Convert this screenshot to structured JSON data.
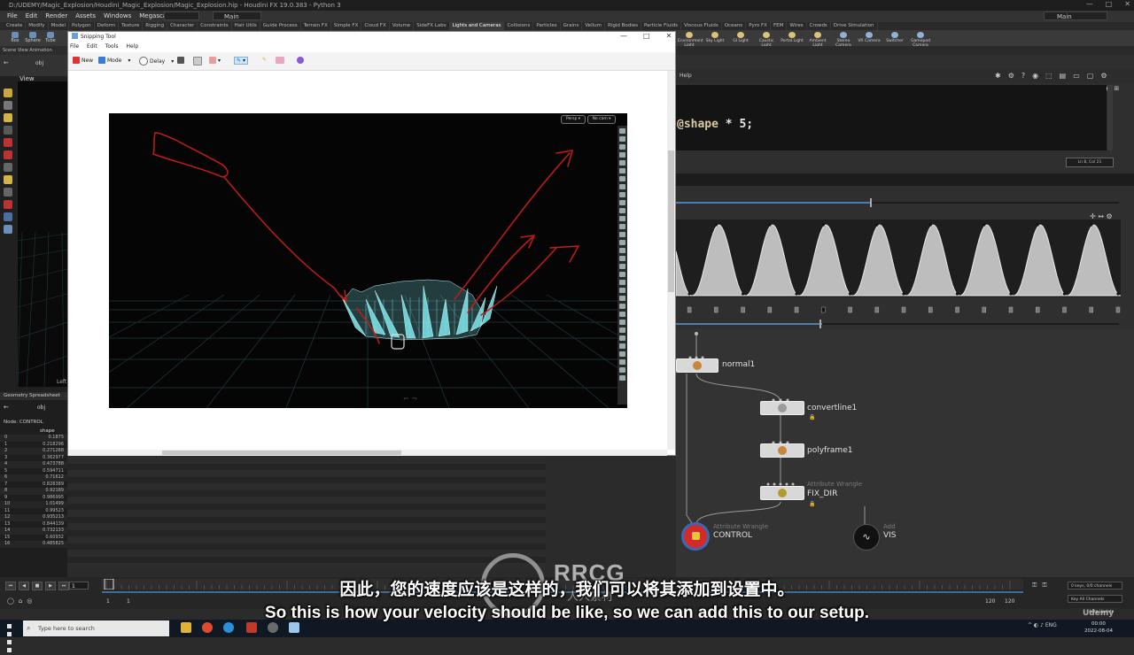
{
  "window": {
    "title": "D:/UDEMY/Magic_Explosion/Houdini_Magic_Explosion/Magic_Explosion.hip - Houdini FX 19.0.383 - Python 3",
    "controls": [
      "—",
      "□",
      "✕"
    ]
  },
  "menubar": [
    "File",
    "Edit",
    "Render",
    "Assets",
    "Windows",
    "Megascans",
    "Help"
  ],
  "build_selector": "Main",
  "desktop_selector": "Main",
  "shelf_tabs": [
    "Create",
    "Modify",
    "Model",
    "Polygon",
    "Deform",
    "Texture",
    "Rigging",
    "Character",
    "Constraints",
    "Hair Utils",
    "Guide Process",
    "Terrain FX",
    "Simple FX",
    "Cloud FX",
    "Volume",
    "SideFX Labs",
    "Lights and Cameras",
    "Collisions",
    "Particles",
    "Grains",
    "Vellum",
    "Rigid Bodies",
    "Particle Fluids",
    "Viscous Fluids",
    "Oceans",
    "Pyro FX",
    "FEM",
    "Wires",
    "Crowds",
    "Drive Simulation"
  ],
  "shelf_tools_left": [
    "Box",
    "Sphere",
    "Tube"
  ],
  "shelf_lights": [
    "Environment Light",
    "Sky Light",
    "GI Light",
    "Caustic Light",
    "Portal Light",
    "Ambient Light",
    "Stereo Camera",
    "VR Camera",
    "Switcher",
    "Gamepad Camera"
  ],
  "left_pane": {
    "tabs": "Scene View   Animation",
    "path": "obj",
    "view_label": "View",
    "axis_label": "Left"
  },
  "spreadsheet": {
    "tab": "Geometry Spreadsheet",
    "path": "obj",
    "node_label": "Node: CONTROL",
    "column": "shape",
    "rows": [
      {
        "i": "0",
        "v": "0.1875"
      },
      {
        "i": "1",
        "v": "0.218296"
      },
      {
        "i": "2",
        "v": "0.271268"
      },
      {
        "i": "3",
        "v": "0.362977"
      },
      {
        "i": "4",
        "v": "0.473788"
      },
      {
        "i": "5",
        "v": "0.594711"
      },
      {
        "i": "6",
        "v": "0.71612"
      },
      {
        "i": "7",
        "v": "0.828389"
      },
      {
        "i": "8",
        "v": "0.92189"
      },
      {
        "i": "9",
        "v": "0.986995"
      },
      {
        "i": "10",
        "v": "1.01499"
      },
      {
        "i": "11",
        "v": "0.99523"
      },
      {
        "i": "12",
        "v": "0.935213"
      },
      {
        "i": "13",
        "v": "0.844139"
      },
      {
        "i": "14",
        "v": "0.732133"
      },
      {
        "i": "15",
        "v": "0.60932"
      },
      {
        "i": "16",
        "v": "0.485825"
      }
    ]
  },
  "snipping_tool": {
    "title": "Snipping Tool",
    "menu": [
      "File",
      "Edit",
      "Tools",
      "Help"
    ],
    "new_label": "New",
    "mode_label": "Mode",
    "delay_label": "Delay",
    "viewport_btn_persp": "Persp ▾",
    "viewport_btn_cam": "No cam ▾"
  },
  "parameter_pane": {
    "help_label": "Help",
    "code_attr": "@shape",
    "code_rest": " * 5;",
    "line_col": "Ln 8, Col 21"
  },
  "nodes": {
    "normal": {
      "name": "normal1"
    },
    "convertline": {
      "name": "convertline1"
    },
    "polyframe": {
      "name": "polyframe1"
    },
    "fixdir": {
      "type": "Attribute Wrangle",
      "name": "FIX_DIR"
    },
    "control": {
      "type": "Attribute Wrangle",
      "name": "CONTROL"
    },
    "vis": {
      "type": "Add",
      "name": "VIS"
    }
  },
  "timeline": {
    "frame": "1",
    "start": "1",
    "start2": "1",
    "end": "120",
    "end2": "120",
    "keys_label": "0 keys, 0/0 channels",
    "all_channels": "Key All Channels",
    "auto_update": "Auto Update"
  },
  "taskbar": {
    "search_placeholder": "Type here to search",
    "lang": "ENG",
    "time": "00:00",
    "date": "2022-08-04"
  },
  "subtitles": {
    "zh": "因此，您的速度应该是这样的，我们可以将其添加到设置中。",
    "en": "So this is how your velocity should be like, so we can add this to our setup."
  },
  "watermark": {
    "brand": "RRCG",
    "sub": "人人素材",
    "udemy": "Udemy"
  },
  "colors": {
    "accent_blue": "#4a7fb5",
    "node_red": "#d42a2a",
    "sketch_red": "#c41a1a",
    "burst_cyan": "#7fe6ec",
    "grid_line": "#1d3b3f"
  }
}
